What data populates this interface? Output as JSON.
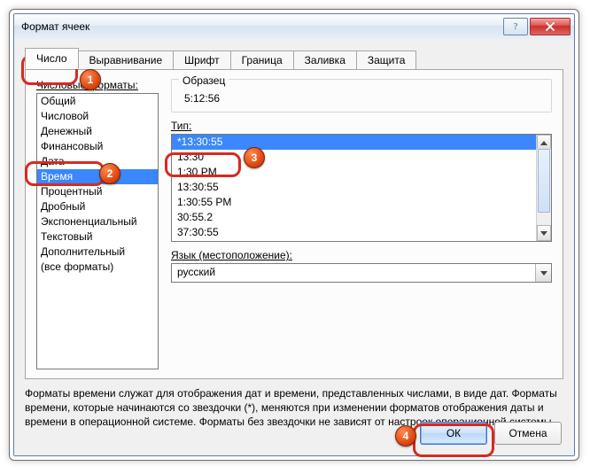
{
  "window": {
    "title": "Формат ячеек"
  },
  "tabs": {
    "items": [
      {
        "label": "Число"
      },
      {
        "label": "Выравнивание"
      },
      {
        "label": "Шрифт"
      },
      {
        "label": "Граница"
      },
      {
        "label": "Заливка"
      },
      {
        "label": "Защита"
      }
    ],
    "active_index": 0
  },
  "number_tab": {
    "categories_label": "Числовые форматы:",
    "categories": [
      "Общий",
      "Числовой",
      "Денежный",
      "Финансовый",
      "Дата",
      "Время",
      "Процентный",
      "Дробный",
      "Экспоненциальный",
      "Текстовый",
      "Дополнительный",
      "(все форматы)"
    ],
    "selected_category_index": 5,
    "sample_label": "Образец",
    "sample_value": "5:12:56",
    "type_label": "Тип:",
    "types": [
      "*13:30:55",
      "13:30",
      "1:30 PM",
      "13:30:55",
      "1:30:55 PM",
      "30:55.2",
      "37:30:55"
    ],
    "selected_type_index": 0,
    "locale_label": "Язык (местоположение):",
    "locale_value": "русский",
    "description": "Форматы времени служат для отображения дат и времени, представленных числами, в виде дат. Форматы времени, которые начинаются со звездочки (*), меняются при изменении форматов отображения даты и времени в операционной системе. Форматы без звездочки не зависят от настроек операционной системы."
  },
  "buttons": {
    "ok": "ОК",
    "cancel": "Отмена"
  },
  "callouts": {
    "n1": "1",
    "n2": "2",
    "n3": "3",
    "n4": "4"
  }
}
